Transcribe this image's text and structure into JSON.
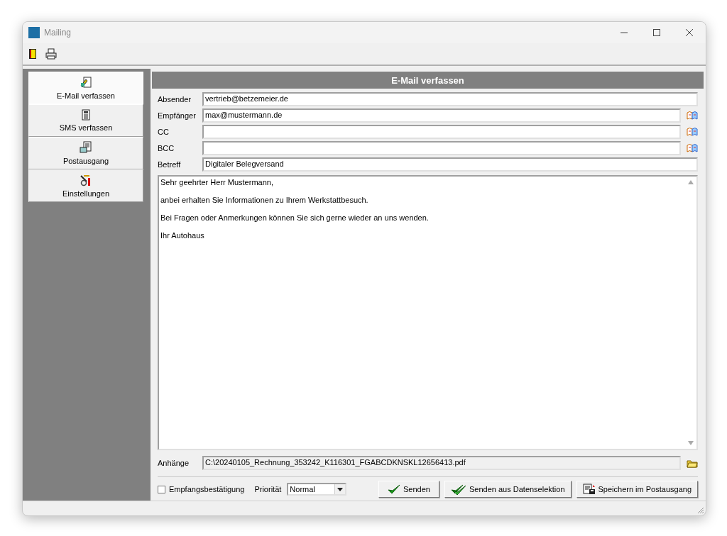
{
  "window": {
    "title": "Mailing"
  },
  "toolbar": [
    {
      "kind": "exit"
    },
    {
      "kind": "print"
    }
  ],
  "sidebar": {
    "items": [
      {
        "label": "E-Mail verfassen",
        "kind": "email",
        "selected": true
      },
      {
        "label": "SMS verfassen",
        "kind": "sms",
        "selected": false
      },
      {
        "label": "Postausgang",
        "kind": "outbox",
        "selected": false
      },
      {
        "label": "Einstellungen",
        "kind": "settings",
        "selected": false
      }
    ]
  },
  "panel": {
    "title": "E-Mail verfassen"
  },
  "fields": [
    {
      "label": "Absender",
      "value": "vertrieb@betzemeier.de",
      "address_book": false
    },
    {
      "label": "Empfänger",
      "value": "max@mustermann.de",
      "address_book": true
    },
    {
      "label": "CC",
      "address_book": true
    },
    {
      "label": "BCC",
      "address_book": true
    },
    {
      "label": "Betreff",
      "value": "Digitaler Belegversand",
      "address_book": false
    }
  ],
  "message": {
    "paragraphs": [
      "Sehr geehrter Herr Mustermann,",
      "anbei erhalten Sie Informationen zu Ihrem Werkstattbesuch.",
      "Bei Fragen oder Anmerkungen können Sie sich gerne wieder an uns wenden.",
      "Ihr Autohaus"
    ]
  },
  "attachments": {
    "label": "Anhänge",
    "value": "C:\\20240105_Rechnung_353242_K116301_FGABCDKNSKL12656413.pdf"
  },
  "receipt": {
    "label": "Empfangsbestätigung",
    "checked": false
  },
  "priority": {
    "label": "Priorität",
    "value": "Normal"
  },
  "buttons": [
    {
      "label": "Senden",
      "kind": "send"
    },
    {
      "label": "Senden aus Datenselektion",
      "kind": "send_multi"
    },
    {
      "label": "Speichern im Postausgang",
      "kind": "save"
    }
  ]
}
